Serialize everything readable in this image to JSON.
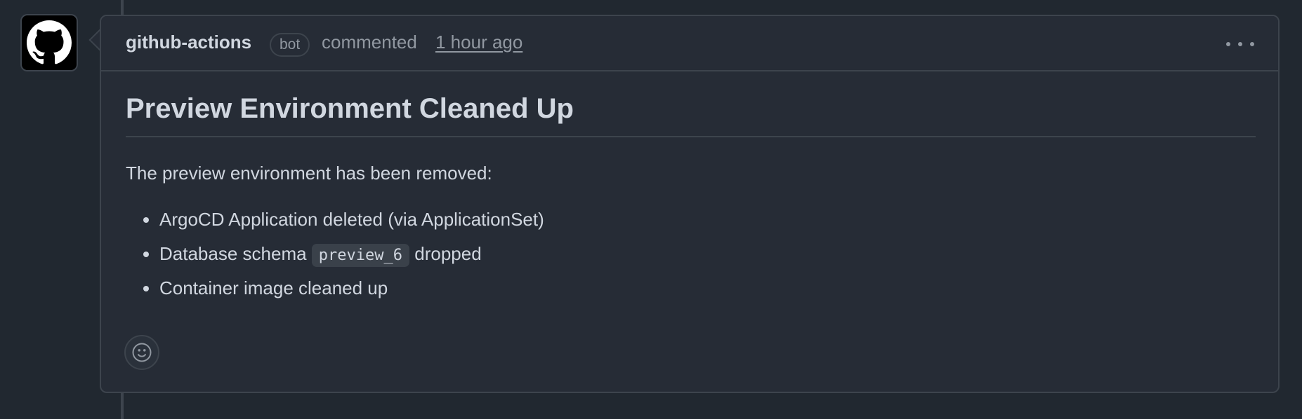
{
  "comment": {
    "author": "github-actions",
    "badge": "bot",
    "action": "commented",
    "timestamp": "1 hour ago",
    "heading": "Preview Environment Cleaned Up",
    "intro": "The preview environment has been removed:",
    "items": [
      {
        "text": "ArgoCD Application deleted (via ApplicationSet)"
      },
      {
        "before": "Database schema",
        "code": "preview_6",
        "after": "dropped"
      },
      {
        "text": "Container image cleaned up"
      }
    ]
  },
  "icons": {
    "avatar": "github-octocat-icon",
    "menu": "kebab-horizontal-icon",
    "reaction": "smiley-icon"
  },
  "colors": {
    "background": "#212830",
    "surface": "#262c36",
    "border": "#3d444d",
    "text": "#d1d7e0",
    "muted": "#9198a1"
  }
}
